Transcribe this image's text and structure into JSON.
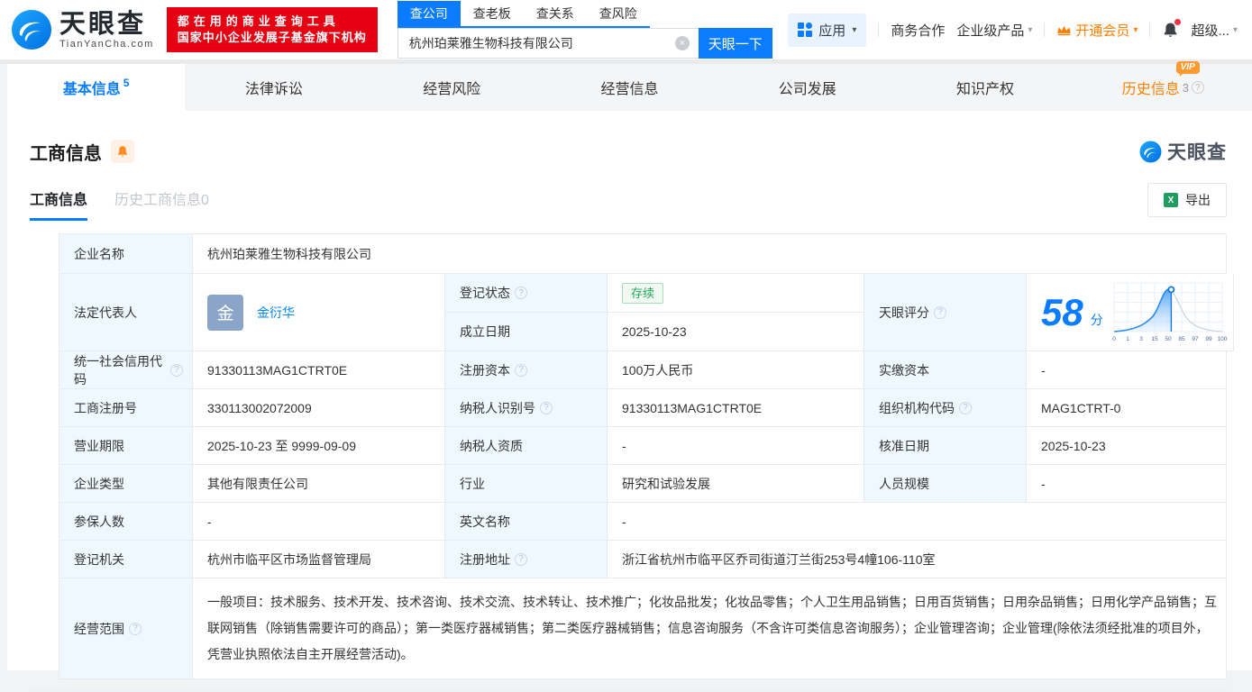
{
  "colors": {
    "accent_blue": "#0b7bff",
    "link_blue": "#0084ff",
    "banner_red": "#e60012",
    "vip_orange": "#ff8000",
    "status_green": "#23a35a",
    "label_cell_bg": "#eff8fe"
  },
  "icons": {
    "clear": "×",
    "caret": "▾",
    "help": "?",
    "excel": "X"
  },
  "header": {
    "brand": "天眼查",
    "brand_domain": "TianYanCha.com",
    "banner_line1": "都在用的商业查询工具",
    "banner_line2": "国家中小企业发展子基金旗下机构",
    "search": {
      "tabs": [
        {
          "label": "查公司",
          "active": true
        },
        {
          "label": "查老板"
        },
        {
          "label": "查关系"
        },
        {
          "label": "查风险"
        }
      ],
      "value": "杭州珀莱雅生物科技有限公司",
      "button": "天眼一下"
    },
    "nav": {
      "apps": "应用",
      "business_coop": "商务合作",
      "enterprise_products": "企业级产品",
      "open_vip": "开通会员",
      "more": "超级..."
    }
  },
  "main_tabs": [
    {
      "label": "基本信息",
      "count": "5",
      "active": true
    },
    {
      "label": "法律诉讼"
    },
    {
      "label": "经营风险"
    },
    {
      "label": "经营信息"
    },
    {
      "label": "公司发展"
    },
    {
      "label": "知识产权"
    },
    {
      "label": "历史信息",
      "count": "3",
      "vip": "VIP"
    }
  ],
  "section": {
    "title": "工商信息",
    "subtabs": [
      {
        "label": "工商信息",
        "active": true
      },
      {
        "label": "历史工商信息0"
      }
    ],
    "export_label": "导出",
    "watermark": "天眼查"
  },
  "score": {
    "label": "天眼评分",
    "value": "58",
    "unit": "分",
    "chart_data": {
      "type": "area",
      "description": "score percentile bell curve, filled up to company score",
      "x_ticks": [
        "0",
        "1",
        "3",
        "15",
        "50",
        "85",
        "97",
        "99",
        "100"
      ],
      "marker_value": 58,
      "peak_at_tick": "50",
      "grid": true
    }
  },
  "fields": {
    "company_name": {
      "label": "企业名称",
      "value": "杭州珀莱雅生物科技有限公司"
    },
    "legal_rep": {
      "label": "法定代表人",
      "avatar": "金",
      "name": "金衍华"
    },
    "reg_status": {
      "label": "登记状态",
      "value": "存续"
    },
    "establish_date": {
      "label": "成立日期",
      "value": "2025-10-23"
    },
    "credit_code": {
      "label": "统一社会信用代码",
      "value": "91330113MAG1CTRT0E"
    },
    "reg_capital": {
      "label": "注册资本",
      "value": "100万人民币"
    },
    "paid_capital": {
      "label": "实缴资本",
      "value": "-"
    },
    "reg_number": {
      "label": "工商注册号",
      "value": "330113002072009"
    },
    "taxpayer_id": {
      "label": "纳税人识别号",
      "value": "91330113MAG1CTRT0E"
    },
    "org_code": {
      "label": "组织机构代码",
      "value": "MAG1CTRT-0"
    },
    "business_term": {
      "label": "营业期限",
      "value": "2025-10-23 至 9999-09-09"
    },
    "taxpayer_quality": {
      "label": "纳税人资质",
      "value": "-"
    },
    "approval_date": {
      "label": "核准日期",
      "value": "2025-10-23"
    },
    "company_type": {
      "label": "企业类型",
      "value": "其他有限责任公司"
    },
    "industry": {
      "label": "行业",
      "value": "研究和试验发展"
    },
    "staff_size": {
      "label": "人员规模",
      "value": "-"
    },
    "insured_count": {
      "label": "参保人数",
      "value": "-"
    },
    "english_name": {
      "label": "英文名称",
      "value": "-"
    },
    "reg_authority": {
      "label": "登记机关",
      "value": "杭州市临平区市场监督管理局"
    },
    "reg_address": {
      "label": "注册地址",
      "value": "浙江省杭州市临平区乔司街道汀兰街253号4幢106-110室"
    },
    "business_scope": {
      "label": "经营范围",
      "value": "一般项目：技术服务、技术开发、技术咨询、技术交流、技术转让、技术推广；化妆品批发；化妆品零售；个人卫生用品销售；日用百货销售；日用杂品销售；日用化学产品销售；互联网销售（除销售需要许可的商品）；第一类医疗器械销售；第二类医疗器械销售；信息咨询服务（不含许可类信息咨询服务）；企业管理咨询；企业管理(除依法须经批准的项目外，凭营业执照依法自主开展经营活动)。"
    }
  }
}
